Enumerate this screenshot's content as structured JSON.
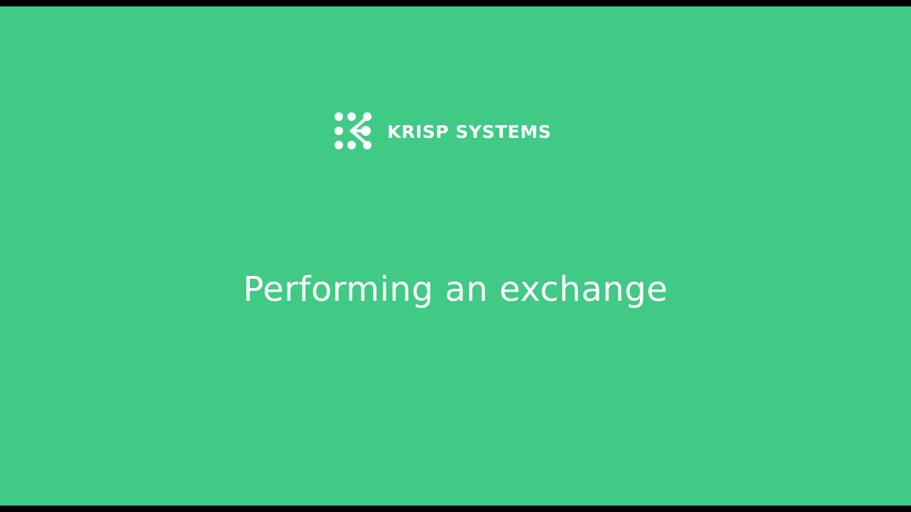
{
  "colors": {
    "background": "#41c986",
    "letterbox": "#000000",
    "text": "#ffffff"
  },
  "logo": {
    "icon": "krisp-dots-logo-icon",
    "name": "KRISP SYSTEMS"
  },
  "slide": {
    "title": "Performing an exchange"
  }
}
